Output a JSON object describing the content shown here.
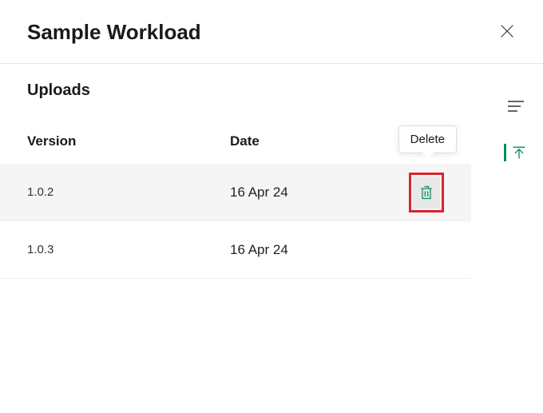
{
  "header": {
    "title": "Sample Workload"
  },
  "section": {
    "title": "Uploads"
  },
  "table": {
    "headers": {
      "version": "Version",
      "date": "Date"
    },
    "rows": [
      {
        "version": "1.0.2",
        "date": "16 Apr 24"
      },
      {
        "version": "1.0.3",
        "date": "16 Apr 24"
      }
    ]
  },
  "tooltip": {
    "delete": "Delete"
  },
  "colors": {
    "accent": "#0a8a67",
    "highlight": "#d9252a"
  }
}
